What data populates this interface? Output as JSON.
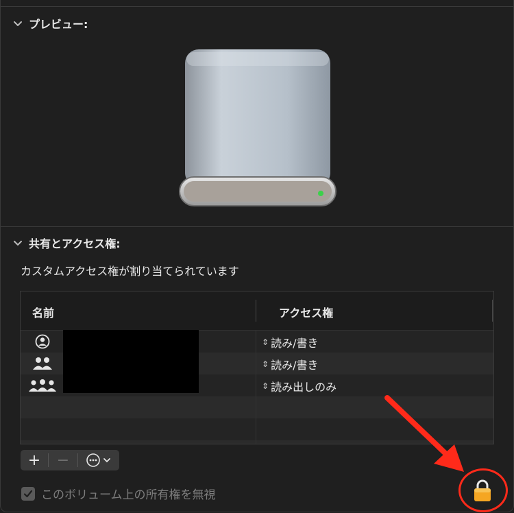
{
  "preview": {
    "header": "プレビュー:"
  },
  "sharing": {
    "header": "共有とアクセス権:",
    "status": "カスタムアクセス権が割り当てられています",
    "columns": {
      "name": "名前",
      "access": "アクセス権"
    },
    "rows": [
      {
        "icon": "user-icon",
        "access": "読み/書き"
      },
      {
        "icon": "group-icon",
        "access": "読み/書き"
      },
      {
        "icon": "everyone-icon",
        "access": "読み出しのみ"
      }
    ]
  },
  "toolbar": {
    "add": "+",
    "remove": "−"
  },
  "ignore_ownership": {
    "label": "このボリューム上の所有権を無視",
    "checked": true
  },
  "colors": {
    "annotation": "#ff2a1a",
    "lock": "#f5a623",
    "led": "#3bd14a"
  }
}
